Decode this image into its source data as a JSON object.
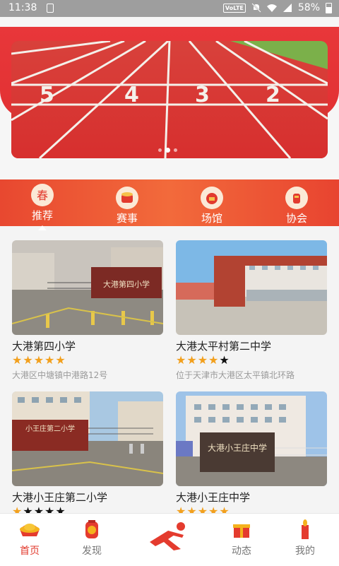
{
  "status_bar": {
    "time": "11:38",
    "network": "VoLTE",
    "battery": "58%"
  },
  "banner": {
    "image": "running-track-lanes-photo",
    "lane_numbers": [
      "5",
      "4",
      "3",
      "2"
    ]
  },
  "categories": [
    {
      "label": "推荐",
      "icon": "recommend-icon",
      "active": true
    },
    {
      "label": "赛事",
      "icon": "drum-icon"
    },
    {
      "label": "场馆",
      "icon": "venue-icon"
    },
    {
      "label": "协会",
      "icon": "association-icon"
    }
  ],
  "venues": [
    {
      "name": "大港第四小学",
      "rating": 5,
      "address": "大港区中塘镇中港路12号",
      "sign_text": "大港第四小学"
    },
    {
      "name": "大港太平村第二中学",
      "rating": 4,
      "address": "位于天津市大港区太平镇北环路"
    },
    {
      "name": "大港小王庄第二小学",
      "rating": 1,
      "address": "",
      "sign_text": "小王庄第二小学"
    },
    {
      "name": "大港小王庄中学",
      "rating": 5,
      "address": "",
      "sign_text": "大港小王庄中学"
    }
  ],
  "bottom_nav": [
    {
      "label": "首页",
      "icon": "home-gold-icon",
      "active": true
    },
    {
      "label": "发现",
      "icon": "discover-icon"
    },
    {
      "label": "",
      "icon": "runner-logo-icon"
    },
    {
      "label": "动态",
      "icon": "gift-icon"
    },
    {
      "label": "我的",
      "icon": "candle-icon"
    }
  ],
  "colors": {
    "accent": "#e23a2e",
    "star": "#f2a01d",
    "strip": "#f26a3b"
  }
}
